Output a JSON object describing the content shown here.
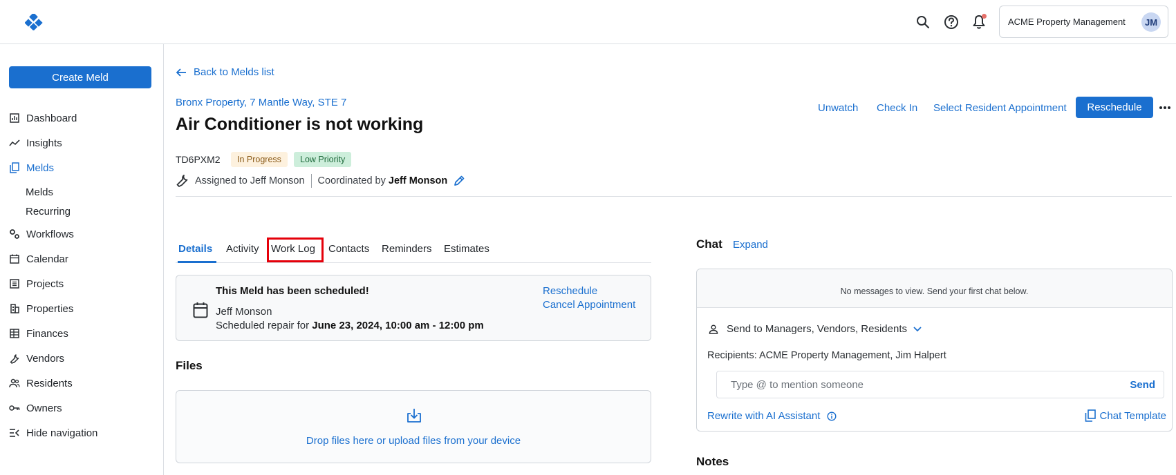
{
  "header": {
    "org_name": "ACME Property Management",
    "avatar_initials": "JM",
    "icons": [
      "search-icon",
      "help-icon",
      "bell-icon"
    ]
  },
  "sidebar": {
    "create_label": "Create Meld",
    "items": [
      {
        "label": "Dashboard",
        "icon": "dashboard-icon"
      },
      {
        "label": "Insights",
        "icon": "insights-icon"
      },
      {
        "label": "Melds",
        "icon": "melds-icon",
        "active": true
      },
      {
        "label": "Workflows",
        "icon": "workflows-icon"
      },
      {
        "label": "Calendar",
        "icon": "calendar-icon"
      },
      {
        "label": "Projects",
        "icon": "projects-icon"
      },
      {
        "label": "Properties",
        "icon": "properties-icon"
      },
      {
        "label": "Finances",
        "icon": "finances-icon"
      },
      {
        "label": "Vendors",
        "icon": "vendors-icon"
      },
      {
        "label": "Residents",
        "icon": "residents-icon"
      },
      {
        "label": "Owners",
        "icon": "owners-icon"
      },
      {
        "label": "Hide navigation",
        "icon": "hide-nav-icon"
      }
    ],
    "sub_items": [
      "Melds",
      "Recurring"
    ]
  },
  "main": {
    "back_label": "Back to Melds list",
    "property_link": "Bronx Property, 7 Mantle Way, STE 7",
    "title": "Air Conditioner is not working",
    "actions": {
      "unwatch": "Unwatch",
      "check_in": "Check In",
      "select_appt": "Select Resident Appointment",
      "reschedule": "Reschedule"
    },
    "meld_id": "TD6PXM2",
    "status_badge": "In Progress",
    "priority_badge": "Low Priority",
    "assigned_text": "Assigned to Jeff Monson",
    "coordinated_label": "Coordinated by",
    "coordinated_name": "Jeff Monson"
  },
  "tabs": [
    "Details",
    "Activity",
    "Work Log",
    "Contacts",
    "Reminders",
    "Estimates"
  ],
  "schedule": {
    "title": "This Meld has been scheduled!",
    "person": "Jeff Monson",
    "time_prefix": "Scheduled repair for",
    "time_value": "June 23, 2024, 10:00 am - 12:00 pm",
    "reschedule_link": "Reschedule",
    "cancel_link": "Cancel Appointment"
  },
  "files": {
    "heading": "Files",
    "drop_text": "Drop files here or upload files from your device"
  },
  "chat": {
    "heading": "Chat",
    "expand": "Expand",
    "empty_text": "No messages to view. Send your first chat below.",
    "send_to": "Send to Managers, Vendors, Residents",
    "recipients": "Recipients: ACME Property Management, Jim Halpert",
    "input_placeholder": "Type @ to mention someone",
    "send_label": "Send",
    "ai_label": "Rewrite with AI Assistant",
    "template_label": "Chat Template"
  },
  "notes": {
    "heading": "Notes"
  },
  "colors": {
    "accent": "#1a6fcf",
    "highlight": "#e5000a"
  }
}
